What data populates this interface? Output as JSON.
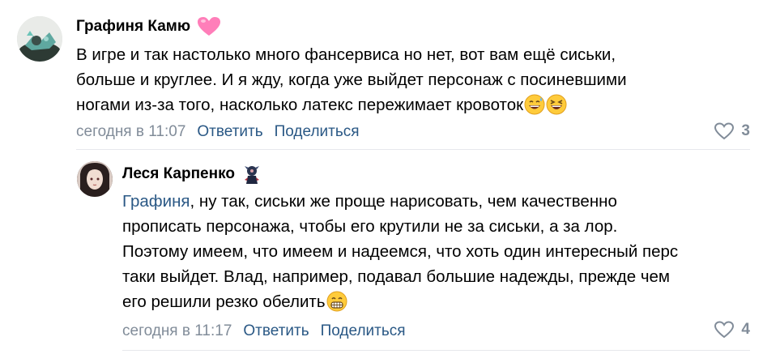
{
  "comments": [
    {
      "author": "Графиня Камю",
      "author_badge": "pink-heart-icon",
      "text_lines": [
        "В игре и так настолько много фансервиса но нет, вот вам ещё сиськи,",
        "больше и круглее. И я жду, когда уже выйдет персонаж с посиневшими",
        "ногами из-за того, насколько латекс пережимает кровоток"
      ],
      "emojis": [
        "grinning-sweat-emoji",
        "laughing-squint-emoji"
      ],
      "time": "сегодня в 11:07",
      "reply_label": "Ответить",
      "share_label": "Поделиться",
      "likes": "3"
    },
    {
      "author": "Леся Карпенко",
      "author_badge": "character-figure-icon",
      "mention": "Графиня",
      "text_lines": [
        ", ну так, сиськи же проще нарисовать, чем качественно",
        "прописать персонажа, чтобы его крутили не за сиськи, а за лор.",
        "Поэтому имеем, что имеем и надеемся, что хоть один интересный перс",
        "таки выйдет. Влад, например, подавал большие надежды, прежде чем",
        "его решили резко обелить"
      ],
      "emojis": [
        "grimacing-emoji"
      ],
      "time": "сегодня в 11:17",
      "reply_label": "Ответить",
      "share_label": "Поделиться",
      "likes": "4"
    }
  ],
  "colors": {
    "link": "#2a5885",
    "meta": "#818c99",
    "divider": "#e7e8ec",
    "badge_heart": "#ff7eb9"
  }
}
